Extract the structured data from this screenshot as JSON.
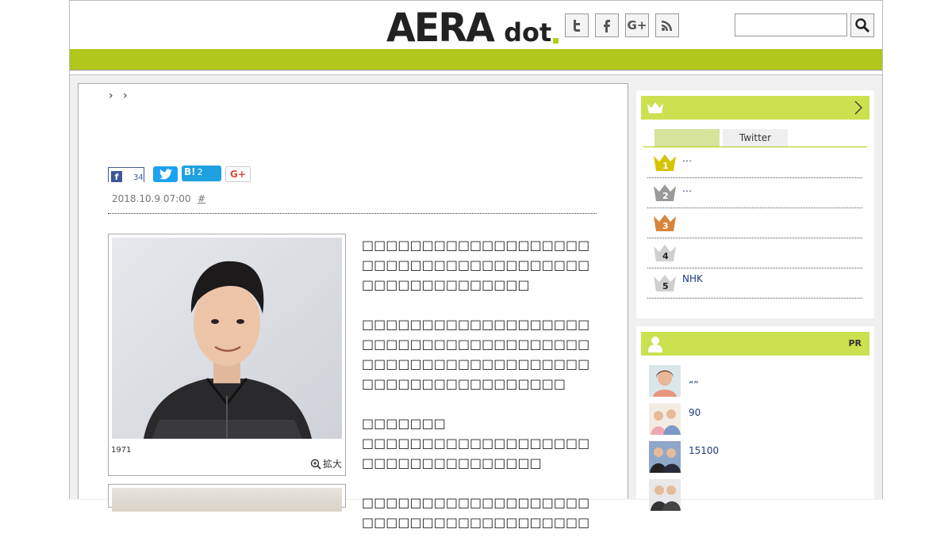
{
  "header": {
    "logo_main": "AERA",
    "logo_sub": "dot",
    "social": [
      {
        "name": "twitter-icon",
        "glyph": "t"
      },
      {
        "name": "facebook-icon",
        "glyph": "f"
      },
      {
        "name": "google-plus-icon",
        "glyph": "G+"
      },
      {
        "name": "rss-icon",
        "glyph": ""
      }
    ],
    "search_value": ""
  },
  "breadcrumb": {
    "sep1": "›",
    "sep2": "›"
  },
  "share": {
    "facebook_count": "34",
    "hatena_label": "B!",
    "hatena_count": "2",
    "gplus_label": "G+"
  },
  "article": {
    "date": "2018.10.9 07:00",
    "hash": "#",
    "photo_caption": "1971",
    "zoom_label": "拡大",
    "paragraphs": [
      "□□□□□□□□□□□□□□□□□□□□□□□□□□□□□□□□□□□□□□□□□□□□□□□□□□□□",
      "□□□□□□□□□□□□□□□□□□□□□□□□□□□□□□□□□□□□□□□□□□□□□□□□□□□□□□□□□□□□□□□□□□□□□□□□□□",
      "□□□□□□□",
      "□□□□□□□□□□□□□□□□□□□□□□□□□□□□□□□□□□",
      "□□□□□□□□□□□□□□□□□□□□□□□□□□□□□□□□□□□□□□"
    ]
  },
  "ranking": {
    "tabs": [
      "",
      "Twitter"
    ],
    "items": [
      {
        "rank": "1",
        "text": "…",
        "color": "#d6c400"
      },
      {
        "rank": "2",
        "text": "…",
        "color": "#9a9a9a"
      },
      {
        "rank": "3",
        "text": "",
        "color": "#d8843a"
      },
      {
        "rank": "4",
        "text": "",
        "color": "#cfcfcf"
      },
      {
        "rank": "5",
        "text": "NHK",
        "color": "#cfcfcf"
      }
    ]
  },
  "pr": {
    "label": "PR",
    "items": [
      {
        "text": "“”"
      },
      {
        "text": "90"
      },
      {
        "text": "15100"
      },
      {
        "text": ""
      }
    ]
  },
  "colors": {
    "accent": "#b1c71a",
    "panel_head": "#cbe150",
    "link": "#1a3b7a"
  }
}
